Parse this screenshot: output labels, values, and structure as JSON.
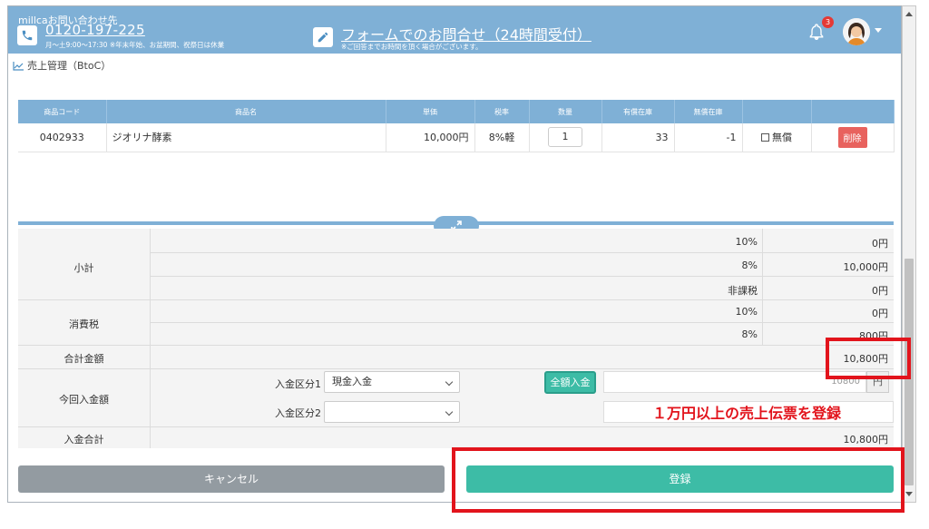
{
  "header": {
    "contact_title": "millcaお問い合わせ先",
    "phone_number": "0120-197-225",
    "hours": "月～土9:00～17:30 ※年末年始、お盆期間、祝祭日は休業",
    "form_link": "フォームでのお問合せ（24時間受付）",
    "form_note": "※ご回答までお時間を頂く場合がございます。",
    "notification_count": "3"
  },
  "breadcrumb": "売上管理（BtoC）",
  "products_table": {
    "columns": [
      "商品コード",
      "商品名",
      "単価",
      "税率",
      "数量",
      "有償在庫",
      "無償在庫",
      "",
      ""
    ],
    "rows": [
      {
        "code": "0402933",
        "name": "ジオリナ酵素",
        "unit_price": "10,000円",
        "tax_rate": "8%軽",
        "quantity": "1",
        "paid_stock": "33",
        "free_stock": "-1",
        "free_label": "無償",
        "delete_label": "削除"
      }
    ]
  },
  "summary": {
    "subtotal_label": "小計",
    "subtotal_rows": [
      {
        "rate": "10%",
        "amount": "0円"
      },
      {
        "rate": "8%",
        "amount": "10,000円"
      },
      {
        "rate": "非課税",
        "amount": "0円"
      }
    ],
    "tax_label": "消費税",
    "tax_rows": [
      {
        "rate": "10%",
        "amount": "0円"
      },
      {
        "rate": "8%",
        "amount": "800円"
      }
    ],
    "total_label": "合計金額",
    "total_amount": "10,800円",
    "payment_label": "今回入金額",
    "payment_type1_label": "入金区分1",
    "payment_type1_value": "現金入金",
    "payment_type2_label": "入金区分2",
    "payment_type2_value": "",
    "full_payment_button": "全額入金",
    "payment_amount_value": "10800",
    "yen_unit": "円",
    "payment_total_label": "入金合計",
    "payment_total_amount": "10,800円"
  },
  "buttons": {
    "cancel": "キャンセル",
    "submit": "登録"
  },
  "annotation": "１万円以上の売上伝票を登録",
  "colors": {
    "header_blue": "#7fb0d6",
    "accent_teal": "#3dbca6",
    "delete_red": "#e8625e",
    "annotation_red": "#e2141c"
  }
}
